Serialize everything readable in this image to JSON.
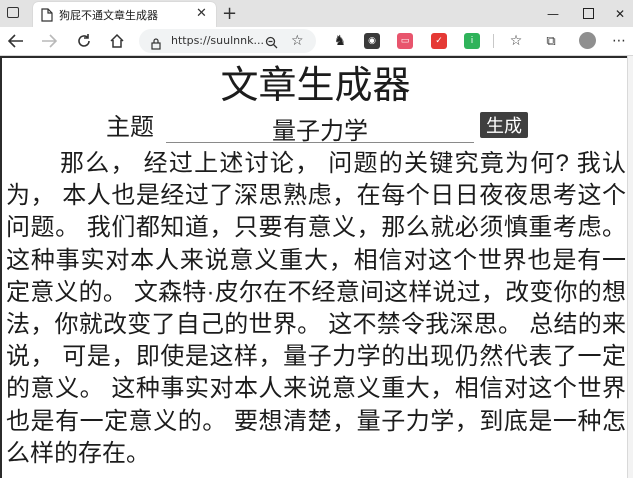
{
  "browser": {
    "tab_title": "狗屁不通文章生成器",
    "address": "https://suulnnk...",
    "icons": [
      "page-icon",
      "close-icon",
      "new-tab-icon",
      "minimize-icon",
      "maximize-icon",
      "window-close-icon",
      "back-icon",
      "forward-icon",
      "reload-icon",
      "home-icon",
      "lock-icon",
      "zoom-icon",
      "favorite-add-icon",
      "favorites-icon",
      "collections-icon",
      "profile-icon"
    ]
  },
  "page": {
    "title": "文章生成器",
    "topic_label": "主题",
    "topic_value": "量子力学",
    "generate_label": "生成",
    "article": "那么， 经过上述讨论， 问题的关键究竟为何? 我认为， 本人也是经过了深思熟虑，在每个日日夜夜思考这个问题。 我们都知道，只要有意义，那么就必须慎重考虑。 这种事实对本人来说意义重大，相信对这个世界也是有一定意义的。 文森特·皮尔在不经意间这样说过，改变你的想法，你就改变了自己的世界。 这不禁令我深思。 总结的来说， 可是，即使是这样，量子力学的出现仍然代表了一定的意义。 这种事实对本人来说意义重大，相信对这个世界也是有一定意义的。 要想清楚，量子力学，到底是一种怎么样的存在。"
  }
}
